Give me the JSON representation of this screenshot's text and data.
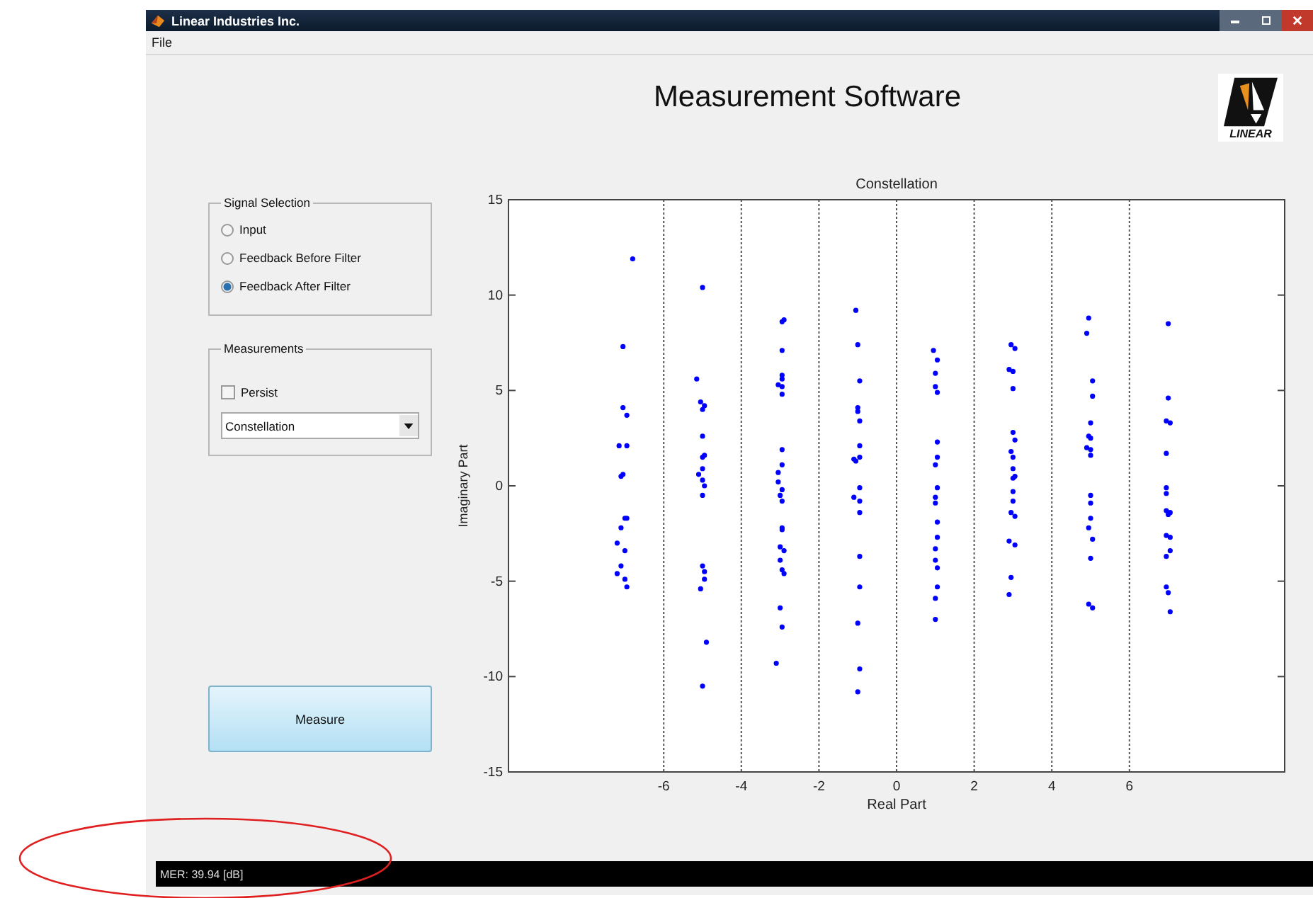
{
  "window": {
    "title": "Linear Industries Inc."
  },
  "menu": [
    "File"
  ],
  "header": {
    "title": "Measurement Software",
    "logo_text": "LINEAR"
  },
  "signal_selection": {
    "title": "Signal Selection",
    "options": [
      {
        "label": "Input",
        "selected": false
      },
      {
        "label": "Feedback Before Filter",
        "selected": false
      },
      {
        "label": "Feedback After Filter",
        "selected": true
      }
    ]
  },
  "measurements": {
    "title": "Measurements",
    "persist": {
      "label": "Persist",
      "checked": false
    },
    "dropdown": {
      "value": "Constellation"
    }
  },
  "measure_button": "Measure",
  "plot": {
    "chart_data": {
      "type": "scatter",
      "grid": true,
      "title": "Constellation",
      "xlabel": "Real Part",
      "ylabel": "Imaginary Part",
      "xlim": [
        -10,
        10
      ],
      "ylim": [
        -15,
        15
      ],
      "xticks": [
        -6,
        -4,
        -2,
        0,
        2,
        4,
        6
      ],
      "yticks": [
        -15,
        -10,
        -5,
        0,
        5,
        10,
        15
      ],
      "x": [
        -6.8,
        -7.05,
        -7.05,
        -6.95,
        -7.15,
        -6.95,
        -7.05,
        -7.1,
        -7.0,
        -6.95,
        -7.1,
        -7.2,
        -7.0,
        -7.1,
        -7.2,
        -7.0,
        -6.95,
        -5.0,
        -5.15,
        -5.05,
        -4.95,
        -5.0,
        -5.0,
        -4.95,
        -5.0,
        -5.0,
        -5.1,
        -5.0,
        -4.95,
        -5.0,
        -5.0,
        -4.95,
        -4.95,
        -5.05,
        -4.9,
        -5.0,
        -2.9,
        -2.95,
        -2.95,
        -2.95,
        -2.95,
        -3.05,
        -2.95,
        -2.95,
        -2.95,
        -2.95,
        -3.05,
        -3.05,
        -2.95,
        -3.0,
        -2.95,
        -2.95,
        -2.95,
        -3.0,
        -2.9,
        -3.0,
        -2.95,
        -2.9,
        -3.0,
        -2.95,
        -3.1,
        -1.05,
        -1.0,
        -0.95,
        -1.0,
        -1.0,
        -0.95,
        -0.95,
        -0.95,
        -1.1,
        -1.05,
        -0.95,
        -1.1,
        -0.95,
        -0.95,
        -0.95,
        -0.95,
        -1.0,
        -0.95,
        -1.0,
        0.95,
        1.05,
        1.0,
        1.0,
        1.05,
        1.05,
        1.05,
        1.0,
        1.05,
        1.0,
        1.0,
        1.05,
        1.05,
        1.0,
        1.0,
        1.05,
        1.05,
        1.0,
        1.0,
        2.95,
        3.05,
        2.9,
        3.0,
        3.0,
        3.0,
        3.05,
        2.95,
        3.0,
        3.0,
        3.05,
        3.0,
        3.0,
        3.0,
        2.95,
        3.05,
        2.9,
        3.05,
        2.95,
        2.9,
        4.95,
        4.9,
        5.05,
        5.05,
        5.0,
        4.95,
        5.0,
        4.9,
        5.0,
        5.0,
        5.0,
        5.0,
        5.0,
        4.95,
        5.05,
        5.0,
        4.95,
        5.05,
        7.0,
        7.0,
        6.95,
        7.05,
        6.95,
        6.95,
        6.95,
        6.95,
        7.05,
        7.0,
        6.95,
        7.05,
        7.05,
        6.95,
        6.95,
        7.0,
        7.05
      ],
      "series": [
        {
          "color": "#0000ff",
          "values": [
            11.9,
            7.3,
            4.1,
            3.7,
            2.1,
            2.1,
            0.6,
            0.5,
            -1.7,
            -1.7,
            -2.2,
            -3.0,
            -3.4,
            -4.2,
            -4.6,
            -4.9,
            -5.3,
            10.4,
            5.6,
            4.4,
            4.2,
            4.0,
            2.6,
            1.6,
            1.5,
            0.9,
            0.6,
            0.3,
            0.0,
            -0.5,
            -4.2,
            -4.5,
            -4.9,
            -5.4,
            -8.2,
            -10.5,
            8.7,
            8.6,
            7.1,
            5.8,
            5.6,
            5.3,
            5.2,
            4.8,
            1.9,
            1.1,
            0.7,
            0.2,
            -0.2,
            -0.5,
            -0.8,
            -2.2,
            -2.3,
            -3.2,
            -3.4,
            -3.9,
            -4.4,
            -4.6,
            -6.4,
            -7.4,
            -9.3,
            9.2,
            7.4,
            5.5,
            4.1,
            3.9,
            3.4,
            2.1,
            1.5,
            1.4,
            1.3,
            -0.1,
            -0.6,
            -0.8,
            -1.4,
            -3.7,
            -5.3,
            -7.2,
            -9.6,
            -10.8,
            7.1,
            6.6,
            5.9,
            5.2,
            4.9,
            2.3,
            1.5,
            1.1,
            -0.1,
            -0.6,
            -0.9,
            -1.9,
            -2.7,
            -3.3,
            -3.9,
            -4.3,
            -5.3,
            -5.9,
            -7.0,
            7.4,
            7.2,
            6.1,
            6.0,
            5.1,
            2.8,
            2.4,
            1.8,
            1.5,
            0.9,
            0.5,
            0.4,
            -0.3,
            -0.8,
            -1.4,
            -1.6,
            -2.9,
            -3.1,
            -4.8,
            -5.7,
            8.8,
            8.0,
            5.5,
            4.7,
            3.3,
            2.6,
            2.5,
            2.0,
            1.9,
            1.6,
            -0.5,
            -0.9,
            -1.7,
            -2.2,
            -2.8,
            -3.8,
            -6.2,
            -6.4,
            8.5,
            4.6,
            3.4,
            3.3,
            1.7,
            -0.1,
            -0.4,
            -1.3,
            -1.4,
            -1.5,
            -2.6,
            -2.7,
            -3.4,
            -3.7,
            -5.3,
            -5.6,
            -6.6
          ]
        }
      ]
    }
  },
  "status_bar": "MER: 39.94 [dB]"
}
